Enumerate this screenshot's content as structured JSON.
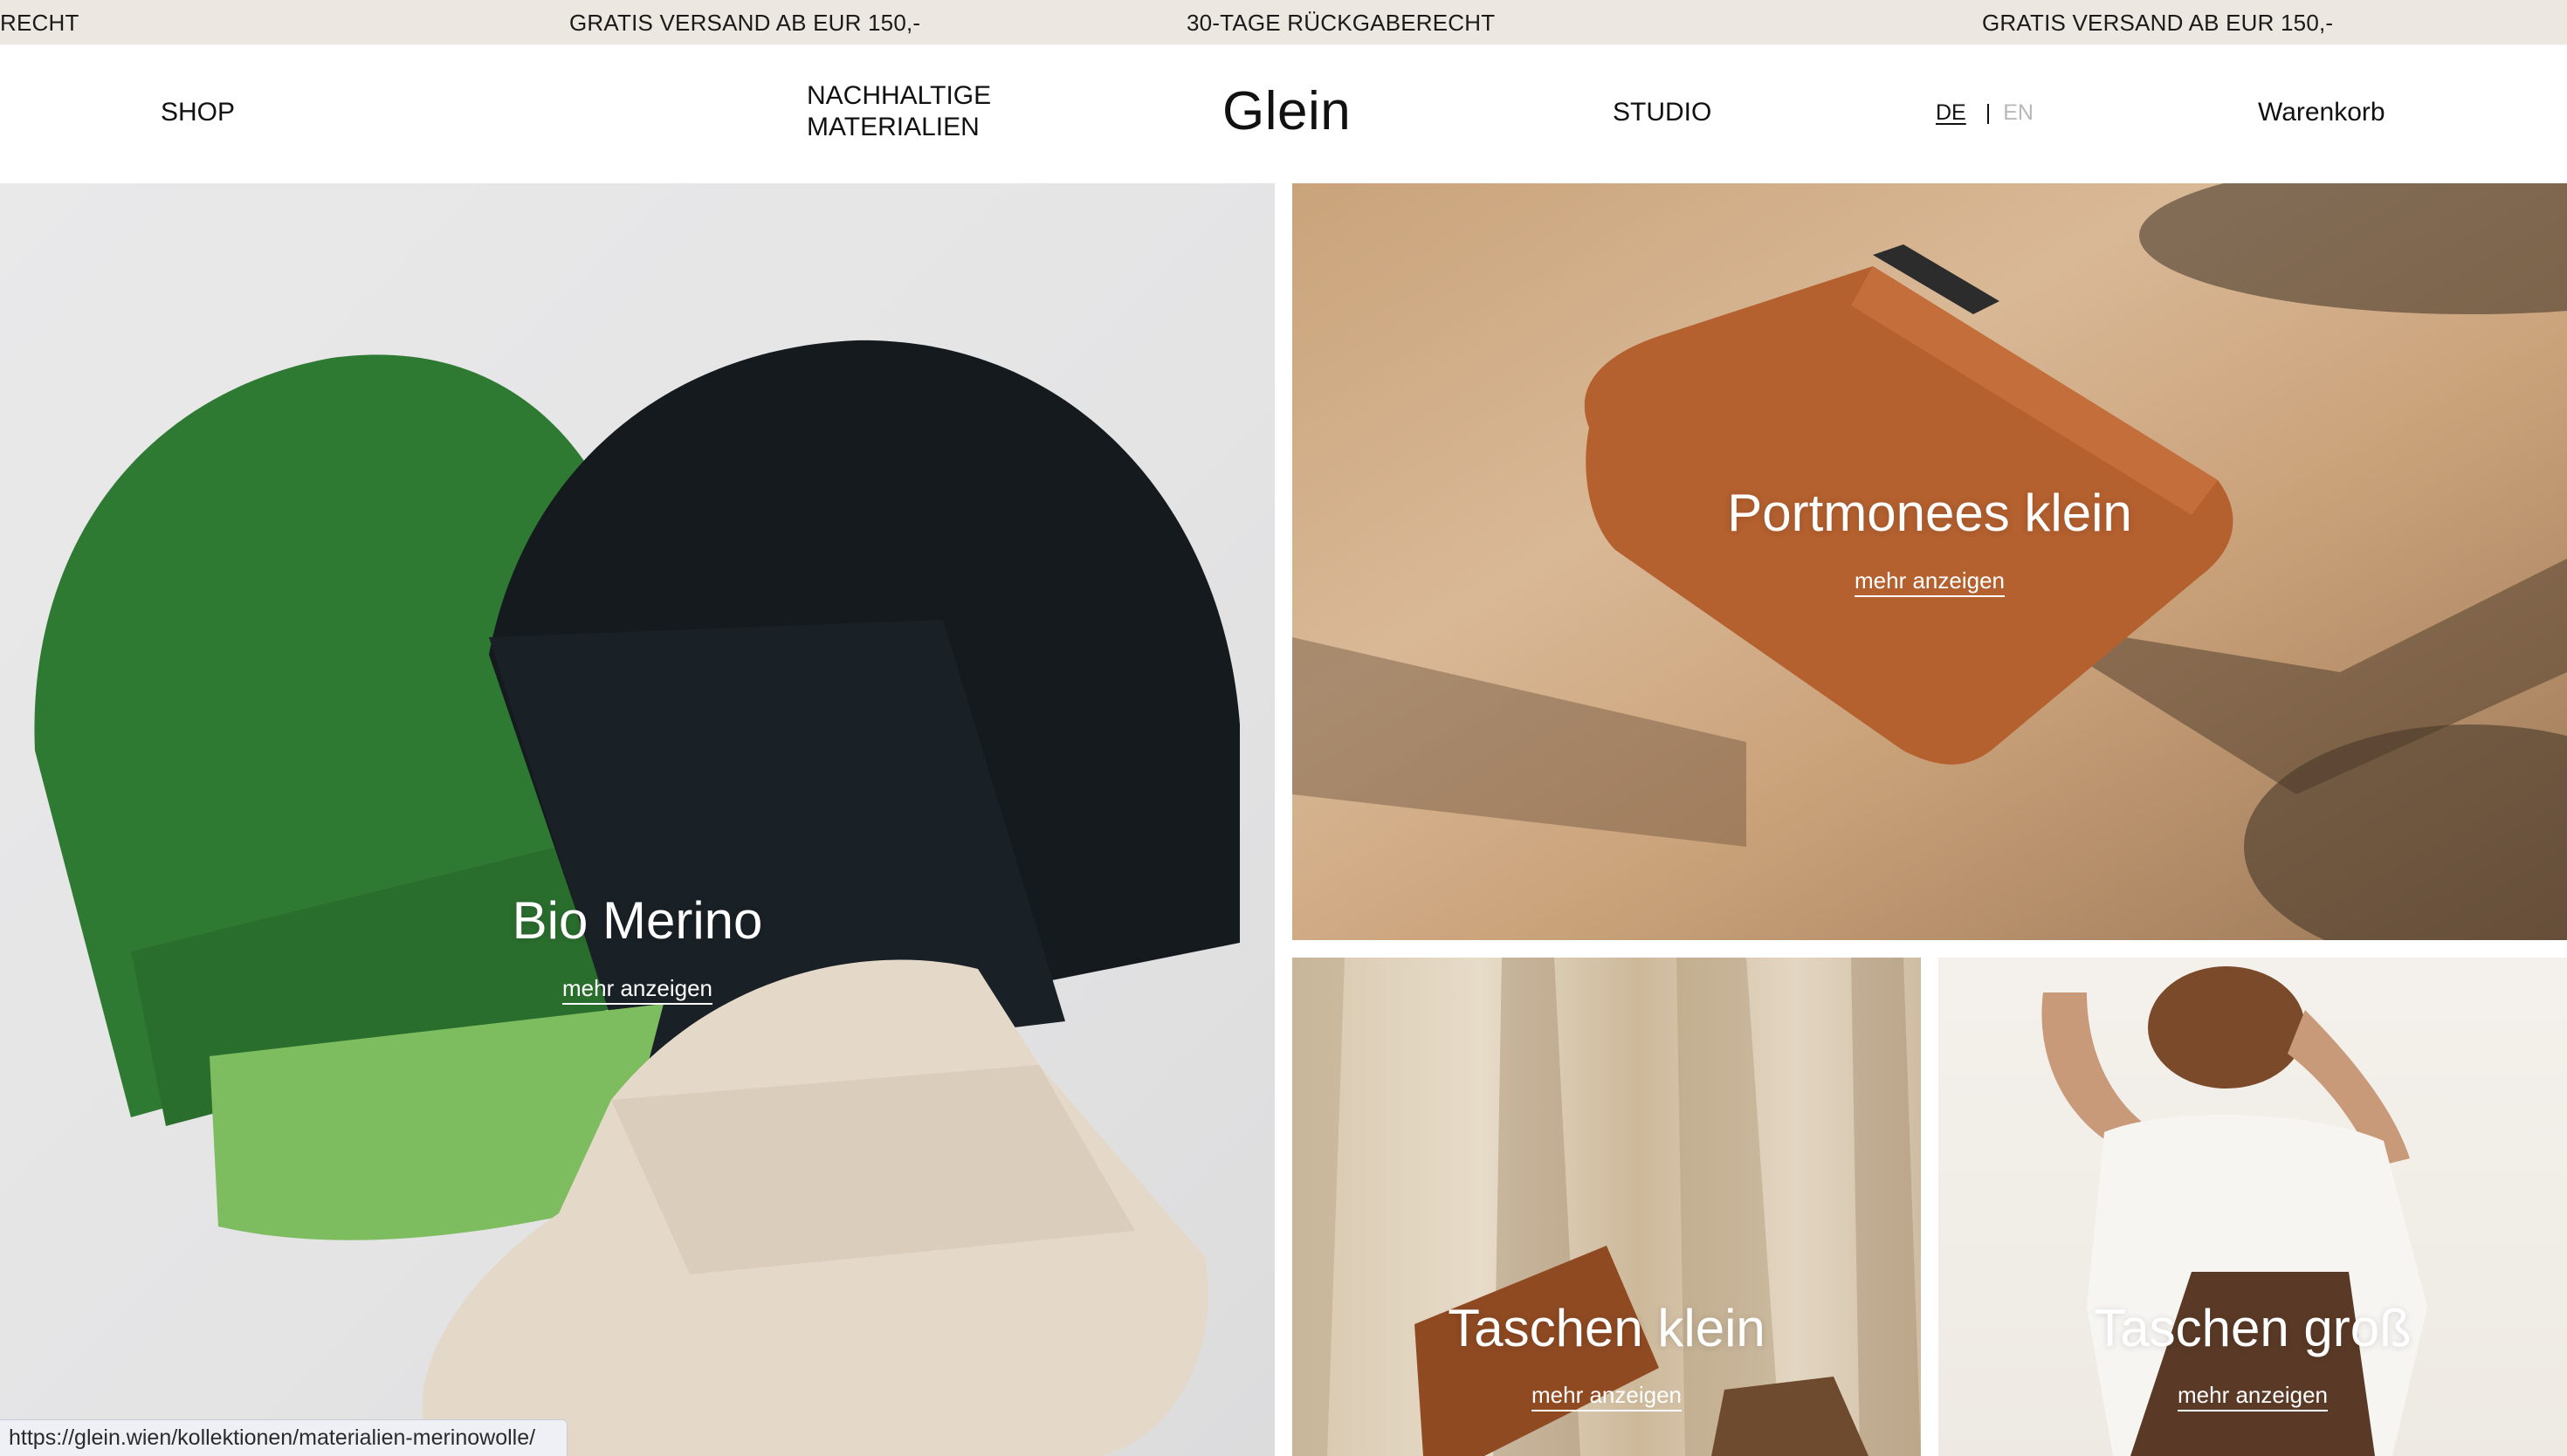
{
  "ticker": {
    "messages": [
      "RECHT",
      "GRATIS VERSAND AB EUR 150,-",
      "30-TAGE RÜCKGABERECHT",
      "GRATIS VERSAND AB EUR 150,-"
    ]
  },
  "header": {
    "nav_shop": "SHOP",
    "nav_materials": "NACHHALTIGE MATERIALIEN",
    "logo": "Glein",
    "nav_studio": "STUDIO",
    "lang_de": "DE",
    "lang_sep": "|",
    "lang_en": "EN",
    "cart": "Warenkorb"
  },
  "tiles": [
    {
      "title": "Bio Merino",
      "link": "mehr anzeigen"
    },
    {
      "title": "Portmonees klein",
      "link": "mehr anzeigen"
    },
    {
      "title": "Taschen klein",
      "link": "mehr anzeigen"
    },
    {
      "title": "Taschen groß",
      "link": "mehr anzeigen"
    }
  ],
  "status": {
    "url": "https://glein.wien/kollektionen/materialien-merinowolle/"
  },
  "colors": {
    "ticker_bg": "#ece7e0",
    "text": "#111111",
    "inactive_lang": "#b8b8b8",
    "beanie_green": "#2f7a33",
    "beanie_light_green": "#7dbd5f",
    "beanie_black": "#141a1e",
    "beanie_cream": "#e4d8c8",
    "leather": "#b4602f"
  }
}
